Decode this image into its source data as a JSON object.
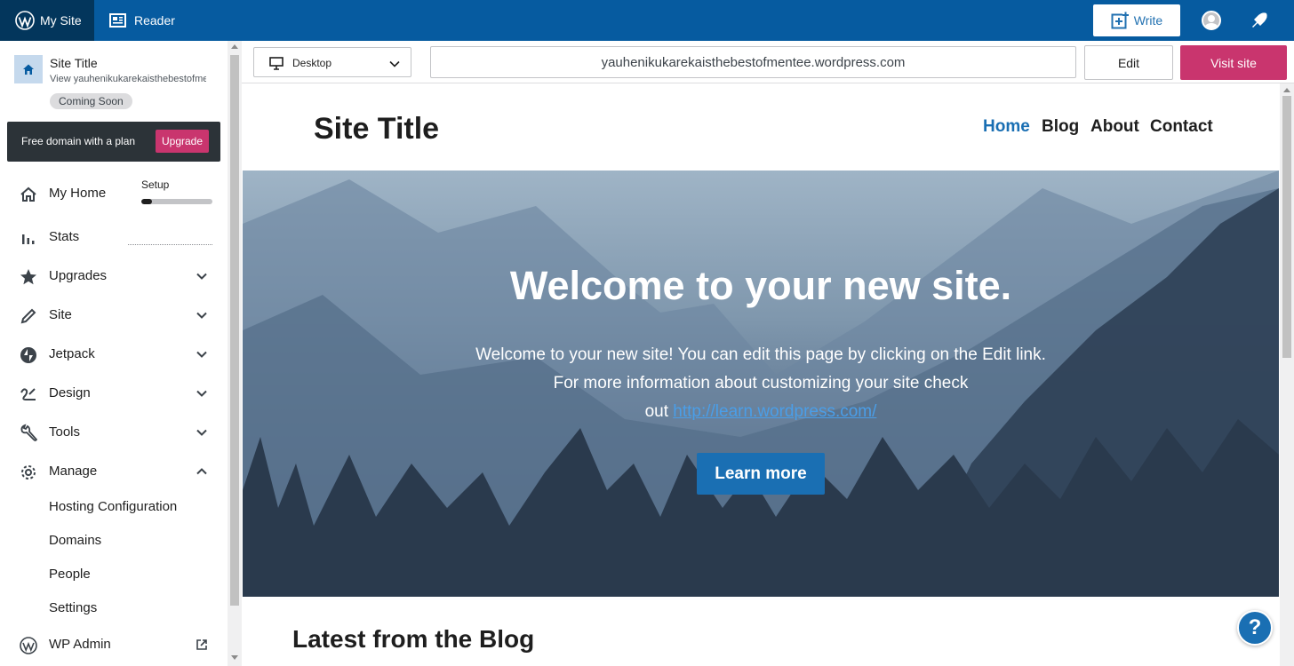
{
  "topbar": {
    "my_site_label": "My Site",
    "reader_label": "Reader",
    "write_label": "Write",
    "brand_color": "#065ba0",
    "active_bg": "#03365c"
  },
  "sidebar": {
    "site_title": "Site Title",
    "site_url": "View yauhenikukarekaisthebestofmentee.wordpress.com",
    "status_badge": "Coming Soon",
    "upsell_text": "Free domain with a plan",
    "upsell_button": "Upgrade",
    "setup_label": "Setup",
    "setup_progress": 0.15,
    "items": [
      {
        "label": "My Home",
        "icon": "home-icon"
      },
      {
        "label": "Stats",
        "icon": "stats-icon"
      },
      {
        "label": "Upgrades",
        "icon": "star-icon"
      },
      {
        "label": "Site",
        "icon": "pencil-icon"
      },
      {
        "label": "Jetpack",
        "icon": "jetpack-icon"
      },
      {
        "label": "Design",
        "icon": "brush-icon"
      },
      {
        "label": "Tools",
        "icon": "wrench-icon"
      },
      {
        "label": "Manage",
        "icon": "gear-icon"
      }
    ],
    "manage_subitems": [
      "Hosting Configuration",
      "Domains",
      "People",
      "Settings"
    ],
    "wp_admin_label": "WP Admin"
  },
  "toolbar": {
    "device_label": "Desktop",
    "url": "yauhenikukarekaisthebestofmentee.wordpress.com",
    "edit_label": "Edit",
    "visit_label": "Visit site",
    "accent": "#c9356e"
  },
  "preview": {
    "site_title": "Site Title",
    "nav": [
      "Home",
      "Blog",
      "About",
      "Contact"
    ],
    "hero_title": "Welcome to your new site.",
    "hero_text_1": "Welcome to your new site! You can edit this page by clicking on the Edit link.",
    "hero_text_2": "For more information about customizing your site check",
    "hero_text_3": "out",
    "hero_link": "http://learn.wordpress.com/",
    "hero_button": "Learn more",
    "latest_heading": "Latest from the Blog",
    "help_label": "?"
  }
}
